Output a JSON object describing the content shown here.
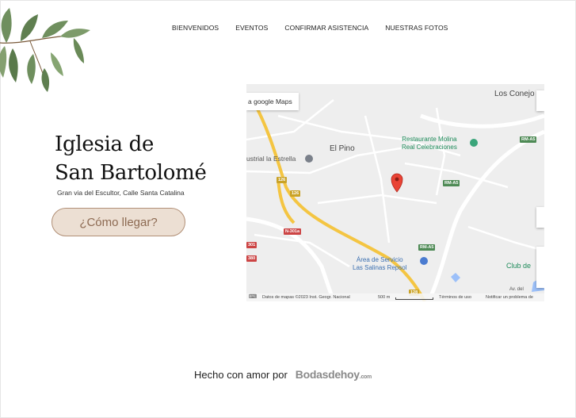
{
  "nav": {
    "items": [
      {
        "label": "BIENVENIDOS"
      },
      {
        "label": "EVENTOS"
      },
      {
        "label": "CONFIRMAR ASISTENCIA"
      },
      {
        "label": "NUESTRAS FOTOS"
      }
    ]
  },
  "venue": {
    "title_line1": "Iglesia de",
    "title_line2": "San Bartolomé",
    "address": "Gran via del Escultor, Calle Santa Catalina",
    "directions_button": "¿Cómo llegar?"
  },
  "map": {
    "open_link": "a google Maps",
    "place_labels": {
      "los_conejos": "Los Conejo",
      "el_pino": "El Pino",
      "industrial": "ustrial la Estrella",
      "restaurant_line1": "Restaurante Molina",
      "restaurant_line2": "Real Celebraciones",
      "service_line1": "Área de Servicio",
      "service_line2": "Las Salinas Repsol",
      "club": "Club de",
      "avenue": "Av. del"
    },
    "road_shields": {
      "rm_a5_top": "RM-A5",
      "rm_a5_mid": "RM-A5",
      "rm_a5_low": "RM-A5",
      "n301a": "N-301a",
      "r126a": "126",
      "r126b": "126",
      "r128": "128",
      "r301": "301",
      "r380": "380"
    },
    "attribution": {
      "data": "Datos de mapas ©2023 Inst. Geogr. Nacional",
      "scale": "500 m",
      "terms": "Términos de uso",
      "report": "Notificar un problema de"
    },
    "colors": {
      "pin": "#e94335",
      "highway": "#f4c542",
      "water": "#9cc0f9"
    }
  },
  "footer": {
    "made_with": "Hecho con amor por",
    "brand": "Bodasdehoy",
    "brand_suffix": ".com"
  }
}
